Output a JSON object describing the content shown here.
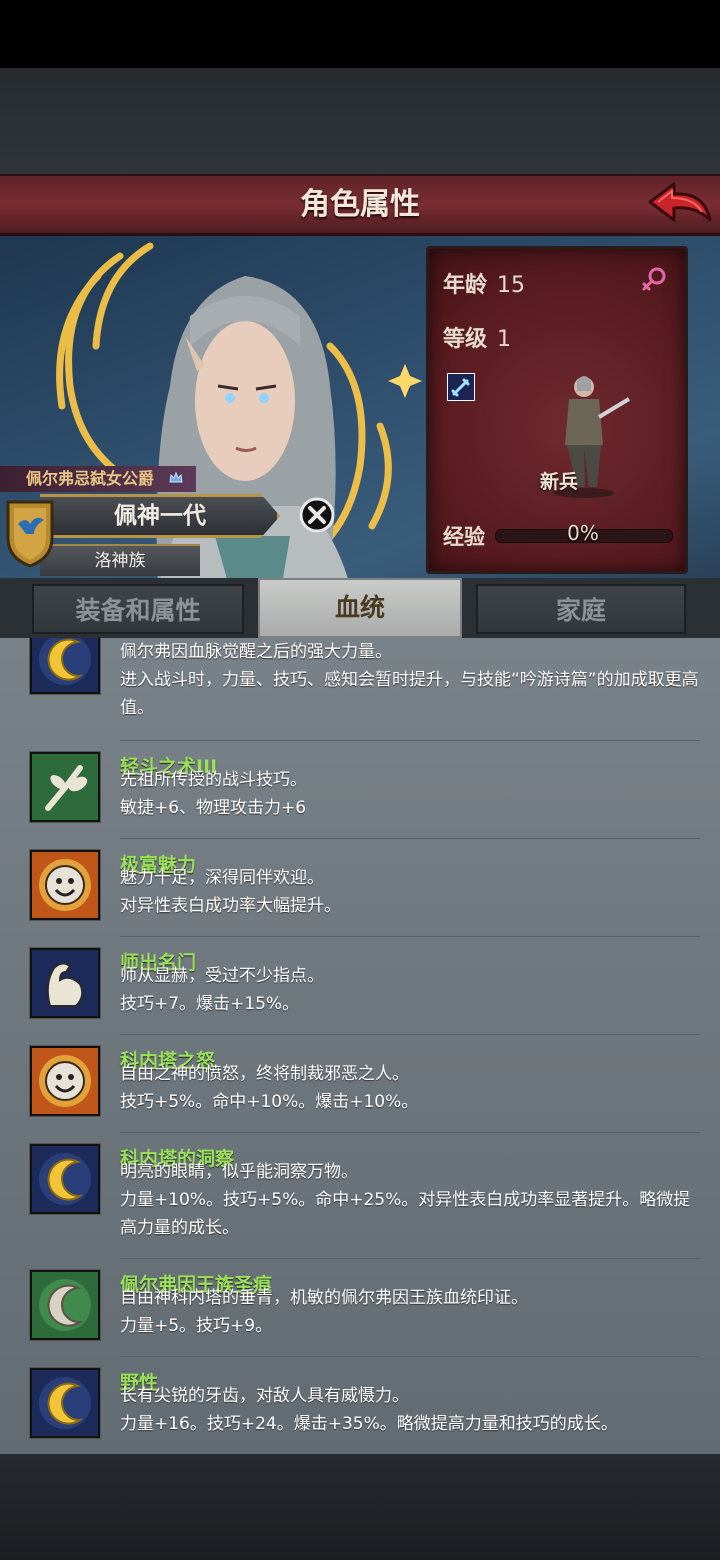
{
  "header": {
    "title": "角色属性"
  },
  "character": {
    "title": "佩尔弗忌弑女公爵",
    "name": "佩神一代",
    "race": "洛神族"
  },
  "stats": {
    "age_label": "年龄",
    "age": "15",
    "level_label": "等级",
    "level": "1",
    "class_label": "新兵",
    "exp_label": "经验",
    "exp_value": "0%",
    "exp_fraction": 0
  },
  "tabs": [
    {
      "label": "装备和属性"
    },
    {
      "label": "血统"
    },
    {
      "label": "家庭"
    }
  ],
  "active_tab": 1,
  "traits": [
    {
      "icon": "crescent-moon-icon",
      "name": "",
      "desc": "佩尔弗因血脉觉醒之后的强大力量。",
      "effect": "进入战斗时，力量、技巧、感知会暂时提升，与技能“吟游诗篇”的加成取更高值。"
    },
    {
      "icon": "branch-icon",
      "name": "轻斗之术III",
      "desc": "先祖所传授的战斗技巧。",
      "effect": "敏捷+6、物理攻击力+6"
    },
    {
      "icon": "smiley-face-icon",
      "name": "极富魅力",
      "desc": "魅力十足，深得同伴欢迎。",
      "effect": "对异性表白成功率大幅提升。"
    },
    {
      "icon": "flexed-arm-icon",
      "name": "师出名门",
      "desc": "师从显赫，受过不少指点。",
      "effect": "技巧+7。爆击+15%。"
    },
    {
      "icon": "smiley-face-icon",
      "name": "科内塔之怒",
      "desc": "自由之神的愤怒，终将制裁邪恶之人。",
      "effect": "技巧+5%。命中+10%。爆击+10%。"
    },
    {
      "icon": "crescent-moon-icon",
      "name": "科内塔的洞察",
      "desc": "明亮的眼睛，似乎能洞察万物。",
      "effect": "力量+10%。技巧+5%。命中+25%。对异性表白成功率显著提升。略微提高力量的成长。"
    },
    {
      "icon": "white-crescent-icon",
      "name": "佩尔弗因王族圣痕",
      "desc": "自由神科内塔的垂青，机敏的佩尔弗因王族血统印证。",
      "effect": "力量+5。技巧+9。"
    },
    {
      "icon": "crescent-moon-icon",
      "name": "野性",
      "desc": "长有尖锐的牙齿，对敌人具有威慑力。",
      "effect": "力量+16。技巧+24。爆击+35%。略微提高力量和技巧的成长。"
    }
  ]
}
